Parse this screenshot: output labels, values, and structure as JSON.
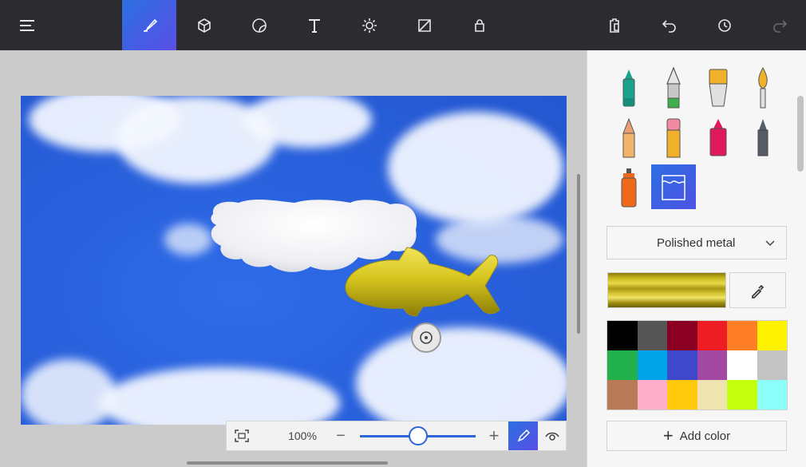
{
  "toolbar": {
    "items": [
      {
        "icon": "menu-icon"
      },
      {
        "icon": "brush-icon",
        "active": true
      },
      {
        "icon": "3d-shapes-icon"
      },
      {
        "icon": "stickers-icon"
      },
      {
        "icon": "text-icon"
      },
      {
        "icon": "effects-icon"
      },
      {
        "icon": "canvas-icon"
      },
      {
        "icon": "magic-select-icon"
      },
      {
        "icon": "paste-icon"
      },
      {
        "icon": "undo-icon"
      },
      {
        "icon": "history-icon"
      },
      {
        "icon": "redo-icon"
      }
    ],
    "accent": "#2b6fe0"
  },
  "canvas": {
    "zoom_label": "100%",
    "zoom_level": 0.5
  },
  "panel": {
    "brushes": [
      {
        "name": "marker",
        "color": "#1aa38c"
      },
      {
        "name": "calligraphy-pen",
        "color": "#3db04a"
      },
      {
        "name": "oil-brush",
        "color": "#f0b02a"
      },
      {
        "name": "watercolor",
        "color": "#f0b02a"
      },
      {
        "name": "pixel-pen",
        "color": "#e8a070"
      },
      {
        "name": "pencil",
        "color": "#f0b02a"
      },
      {
        "name": "eraser",
        "color": "#e0195c"
      },
      {
        "name": "crayon",
        "color": "#555d66"
      },
      {
        "name": "spray-can",
        "color": "#ee6a1a"
      },
      {
        "name": "fill",
        "color": "#ffffff",
        "selected": true
      }
    ],
    "material": "Polished metal",
    "preview_color": "#c9b31a",
    "palette": [
      "#000000",
      "#555555",
      "#8b0022",
      "#ee1c24",
      "#ff7f27",
      "#fff200",
      "#22b14c",
      "#00a2e8",
      "#3f48cc",
      "#a349a4",
      "#ffffff",
      "#c3c3c3",
      "#b97a57",
      "#ffaec9",
      "#ffc90e",
      "#efe4b0",
      "#c4ff0e",
      "#8cfffb"
    ],
    "add_color_label": "Add color"
  }
}
